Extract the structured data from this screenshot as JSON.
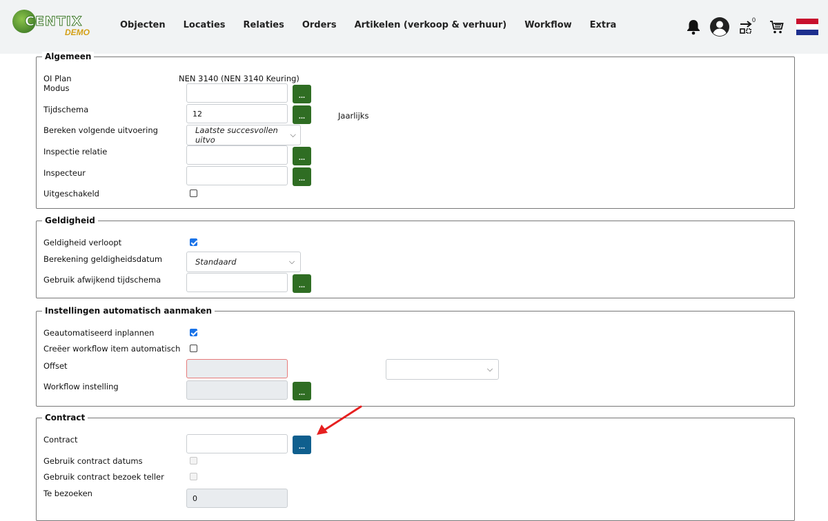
{
  "brand": {
    "name": "CENTIX",
    "tag": "DEMO"
  },
  "nav": [
    "Objecten",
    "Locaties",
    "Relaties",
    "Orders",
    "Artikelen (verkoop & verhuur)",
    "Workflow",
    "Extra"
  ],
  "header_icons": [
    "bell-icon",
    "user-avatar-icon",
    "transfer-icon",
    "cart-icon",
    "flag-nl-icon"
  ],
  "transfer_count": "0",
  "colors": {
    "accent_green": "#2f6d23",
    "accent_blue": "#0f5f8e",
    "check_blue": "#1a73e8"
  },
  "algemeen": {
    "legend": "Algemeen",
    "oi_plan_label": "OI Plan",
    "oi_plan_value": "NEN 3140 (NEN 3140 Keuring)",
    "modus_label": "Modus",
    "modus_value": "",
    "tijdschema_label": "Tijdschema",
    "tijdschema_value": "12",
    "tijdschema_unit": "Jaarlijks",
    "bereken_label": "Bereken volgende uitvoering",
    "bereken_value": "Laatste succesvollen uitvo",
    "inspectie_relatie_label": "Inspectie relatie",
    "inspecteur_label": "Inspecteur",
    "uitgeschakeld_label": "Uitgeschakeld",
    "uitgeschakeld_checked": false,
    "button_label": "..."
  },
  "geldigheid": {
    "legend": "Geldigheid",
    "verloopt_label": "Geldigheid verloopt",
    "verloopt_checked": true,
    "berekening_label": "Berekening geldigheidsdatum",
    "berekening_value": "Standaard",
    "afwijkend_label": "Gebruik afwijkend tijdschema"
  },
  "automatisch": {
    "legend": "Instellingen automatisch aanmaken",
    "inplannen_label": "Geautomatiseerd inplannen",
    "inplannen_checked": true,
    "workflow_item_label": "Creëer workflow item automatisch",
    "workflow_item_checked": false,
    "offset_label": "Offset",
    "workflow_instelling_label": "Workflow instelling"
  },
  "contract": {
    "legend": "Contract",
    "contract_label": "Contract",
    "datums_label": "Gebruik contract datums",
    "teller_label": "Gebruik contract bezoek teller",
    "te_bezoeken_label": "Te bezoeken",
    "te_bezoeken_value": "0"
  }
}
